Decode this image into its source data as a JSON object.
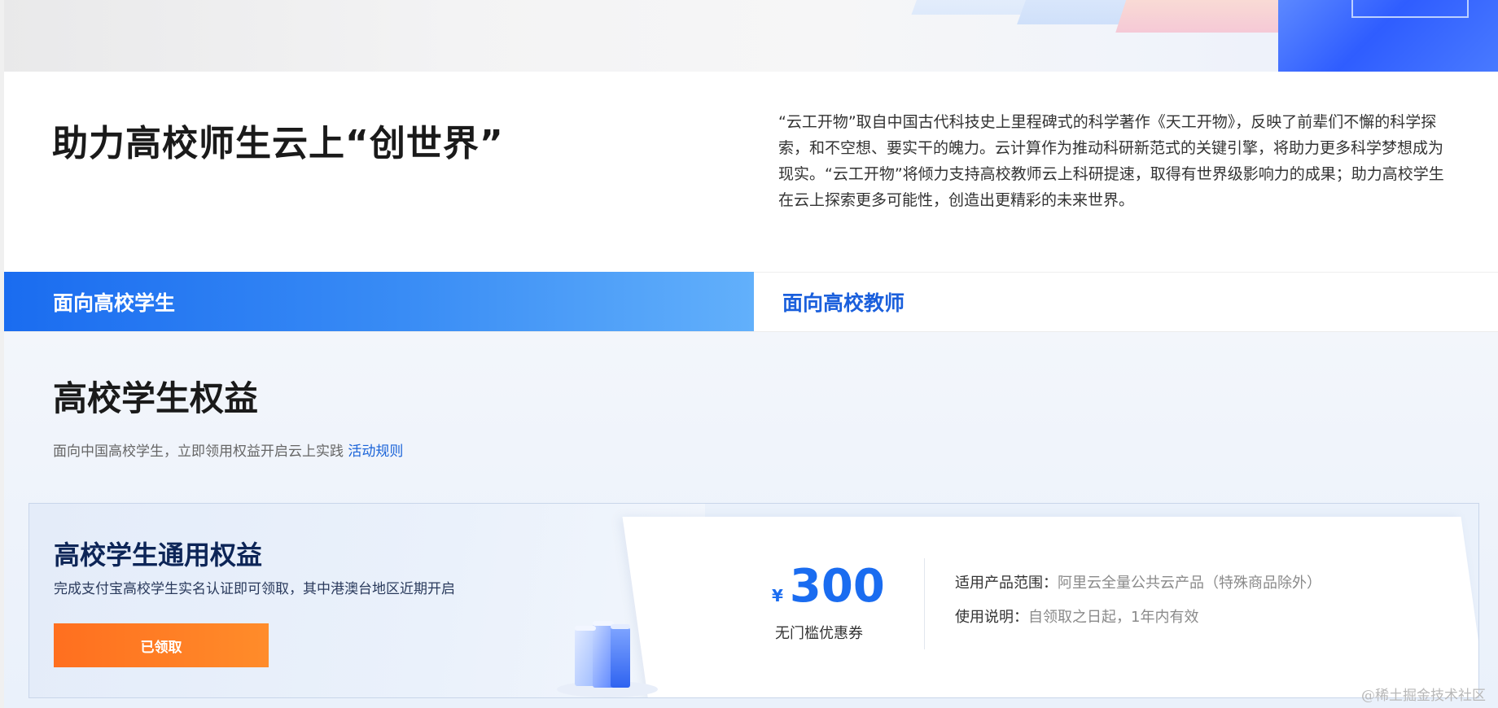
{
  "intro": {
    "title": "助力高校师生云上“创世界”",
    "description": "“云工开物”取自中国古代科技史上里程碑式的科学著作《天工开物》，反映了前辈们不懈的科学探索，和不空想、要实干的魄力。云计算作为推动科研新范式的关键引擎，将助力更多科学梦想成为现实。“云工开物”将倾力支持高校教师云上科研提速，取得有世界级影响力的成果；助力高校学生在云上探索更多可能性，创造出更精彩的未来世界。"
  },
  "tabs": [
    {
      "label": "面向高校学生",
      "active": true
    },
    {
      "label": "面向高校教师",
      "active": false
    }
  ],
  "section": {
    "title": "高校学生权益",
    "subtitle": "面向中国高校学生，立即领用权益开启云上实践",
    "rules_link": "活动规则"
  },
  "benefit_card": {
    "title": "高校学生通用权益",
    "description": "完成支付宝高校学生实名认证即可领取，其中港澳台地区近期开启",
    "button_label": "已领取",
    "coupon": {
      "currency": "¥",
      "amount": "300",
      "label": "无门槛优惠券"
    },
    "scope_label": "适用产品范围：",
    "scope_value": "阿里云全量公共云产品（特殊商品除外）",
    "usage_label": "使用说明：",
    "usage_value": "自领取之日起，1年内有效"
  },
  "watermark": "@稀土掘金技术社区",
  "colors": {
    "primary_blue": "#1a6cf0",
    "tab_inactive_text": "#1a5fdc",
    "button_orange": "#ff7a22",
    "link_blue": "#1a63d8"
  },
  "icons": [
    "books-illustration"
  ]
}
